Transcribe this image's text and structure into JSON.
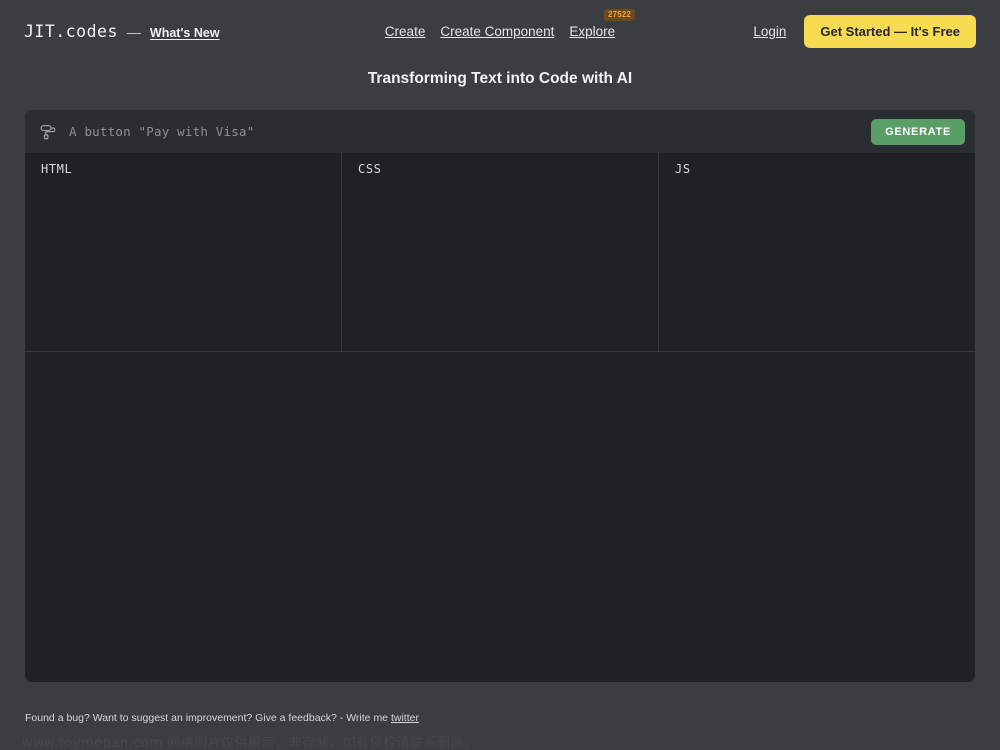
{
  "header": {
    "brand": {
      "logo": "JIT.codes",
      "dash": "—",
      "whats_new": "What's New"
    },
    "nav": [
      {
        "label": "Create",
        "badge": ""
      },
      {
        "label": "Create Component",
        "badge": ""
      },
      {
        "label": "Explore",
        "badge": "27522"
      }
    ],
    "login_label": "Login",
    "cta_label": "Get Started — It's Free",
    "colors": {
      "cta_background": "#f7dc52",
      "cta_text": "#26282b",
      "badge_background": "#6b4a1e",
      "badge_text": "#f0a33c"
    }
  },
  "page_title": "Transforming Text into Code with AI",
  "prompt": {
    "icon": "paint-roller-icon",
    "value": "",
    "placeholder": "A button \"Pay with Visa\"",
    "generate_label": "GENERATE",
    "generate_color": "#5a9e67"
  },
  "editors": [
    {
      "label": "HTML",
      "code": ""
    },
    {
      "label": "CSS",
      "code": ""
    },
    {
      "label": "JS",
      "code": ""
    }
  ],
  "preview": {
    "content": ""
  },
  "footer": {
    "text": "Found a bug? Want to suggest an improvement? Give a feedback? - Write me ",
    "link_label": "twitter"
  },
  "watermark": "www.toymoban.com 网络图片仅供展示，非存储，如有侵权请联系删除。"
}
